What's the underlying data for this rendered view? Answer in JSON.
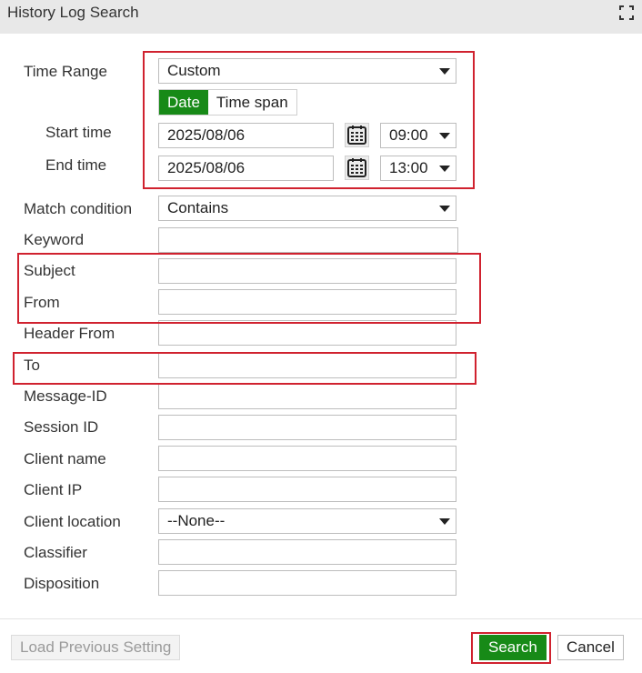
{
  "dialog": {
    "title": "History Log Search"
  },
  "time_range": {
    "label": "Time Range",
    "value": "Custom",
    "mode_tabs": [
      "Date",
      "Time span"
    ],
    "active_tab": "Date",
    "start_label": "Start time",
    "start_date": "2025/08/06",
    "start_hour": "09:00",
    "end_label": "End time",
    "end_date": "2025/08/06",
    "end_hour": "13:00"
  },
  "fields": {
    "match_condition": {
      "label": "Match condition",
      "value": "Contains"
    },
    "keyword": {
      "label": "Keyword",
      "value": ""
    },
    "subject": {
      "label": "Subject",
      "value": ""
    },
    "from": {
      "label": "From",
      "value": ""
    },
    "header_from": {
      "label": "Header From",
      "value": ""
    },
    "to": {
      "label": "To",
      "value": ""
    },
    "message_id": {
      "label": "Message-ID",
      "value": ""
    },
    "session_id": {
      "label": "Session ID",
      "value": ""
    },
    "client_name": {
      "label": "Client name",
      "value": ""
    },
    "client_ip": {
      "label": "Client IP",
      "value": ""
    },
    "client_location": {
      "label": "Client location",
      "value": "--None--"
    },
    "classifier": {
      "label": "Classifier",
      "value": ""
    },
    "disposition": {
      "label": "Disposition",
      "value": ""
    }
  },
  "footer": {
    "load_previous": "Load Previous Setting",
    "search": "Search",
    "cancel": "Cancel"
  },
  "colors": {
    "accent": "#178a17",
    "highlight": "#d0222f"
  }
}
